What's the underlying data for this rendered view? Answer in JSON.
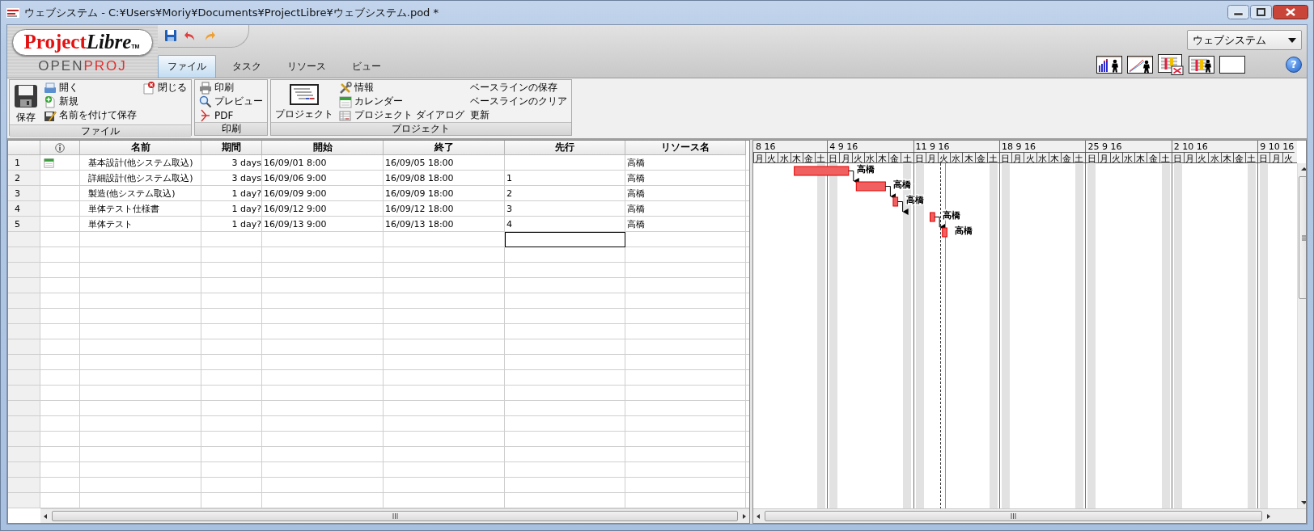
{
  "window": {
    "title": "ウェブシステム - C:¥Users¥Moriy¥Documents¥ProjectLibre¥ウェブシステム.pod *"
  },
  "logo": {
    "name_first": "Project",
    "name_second": "Libre",
    "trademark": "TM",
    "sub_first": "OPEN",
    "sub_second": "PROJ"
  },
  "tabs": [
    {
      "label": "ファイル",
      "selected": true
    },
    {
      "label": "タスク",
      "selected": false
    },
    {
      "label": "リソース",
      "selected": false
    },
    {
      "label": "ビュー",
      "selected": false
    }
  ],
  "project_selector": {
    "value": "ウェブシステム"
  },
  "help_button": {
    "label": "?"
  },
  "ribbon_groups": [
    {
      "label": "ファイル",
      "large": {
        "label": "保存"
      },
      "columns": [
        [
          {
            "label": "開く"
          },
          {
            "label": "新規"
          },
          {
            "label": "名前を付けて保存"
          }
        ],
        [
          {
            "label": "閉じる"
          }
        ]
      ]
    },
    {
      "label": "印刷",
      "columns": [
        [
          {
            "label": "印刷"
          },
          {
            "label": "プレビュー"
          },
          {
            "label": "PDF"
          }
        ]
      ]
    },
    {
      "label": "プロジェクト",
      "large": {
        "label": "プロジェクト"
      },
      "columns": [
        [
          {
            "label": "情報"
          },
          {
            "label": "カレンダー"
          },
          {
            "label": "プロジェクト ダイアログ"
          }
        ],
        [
          {
            "label": "ベースラインの保存"
          },
          {
            "label": "ベースラインのクリア"
          },
          {
            "label": "更新"
          }
        ]
      ]
    }
  ],
  "table": {
    "columns": [
      {
        "kind": "row",
        "focused": false
      },
      {
        "kind": "indicators",
        "focused": false
      },
      {
        "label": "名前",
        "kind": "name",
        "focused": false
      },
      {
        "label": "期間",
        "kind": "duration",
        "focused": false
      },
      {
        "label": "開始",
        "kind": "start",
        "focused": false
      },
      {
        "label": "終了",
        "kind": "finish",
        "focused": false
      },
      {
        "label": "先行",
        "kind": "predecessors",
        "focused": true
      },
      {
        "label": "リソース名",
        "kind": "resources",
        "focused": false
      }
    ],
    "rows": [
      {
        "row": "1",
        "indicator": true,
        "name": "基本設計(他システム取込)",
        "duration": "3 days",
        "start": "16/09/01 8:00",
        "finish": "16/09/05 18:00",
        "resources": "高橋",
        "bar_label": "高橋"
      },
      {
        "row": "2",
        "indicator": false,
        "name": "詳細設計(他システム取込)",
        "duration": "3 days",
        "start": "16/09/06 9:00",
        "finish": "16/09/08 18:00",
        "predecessors": "1",
        "resources": "高橋",
        "bar_label": "高橋"
      },
      {
        "row": "3",
        "indicator": false,
        "name": "製造(他システム取込)",
        "duration": "1 day?",
        "start": "16/09/09 9:00",
        "finish": "16/09/09 18:00",
        "predecessors": "2",
        "resources": "高橋",
        "bar_label": "高橋"
      },
      {
        "row": "4",
        "indicator": false,
        "name": "単体テスト仕様書",
        "duration": "1 day?",
        "start": "16/09/12 9:00",
        "finish": "16/09/12 18:00",
        "predecessors": "3",
        "resources": "高橋",
        "bar_label": "高橋"
      },
      {
        "row": "5",
        "indicator": false,
        "name": "単体テスト",
        "duration": "1 day?",
        "start": "16/09/13 9:00",
        "finish": "16/09/13 18:00",
        "predecessors": "4",
        "resources": "高橋",
        "bar_label": "高橋"
      }
    ]
  },
  "gantt": {
    "weeks": [
      {
        "label": "8 16",
        "days": [
          "月",
          "火",
          "水",
          "木",
          "金",
          "土"
        ]
      },
      {
        "label": "4 9 16",
        "days": [
          "日",
          "月",
          "火",
          "水",
          "木",
          "金",
          "土"
        ]
      },
      {
        "label": "11 9 16",
        "days": [
          "日",
          "月",
          "火",
          "水",
          "木",
          "金",
          "土"
        ]
      },
      {
        "label": "18 9 16",
        "days": [
          "日",
          "月",
          "火",
          "水",
          "木",
          "金",
          "土"
        ]
      },
      {
        "label": "25 9 16",
        "days": [
          "日",
          "月",
          "火",
          "水",
          "木",
          "金",
          "土"
        ]
      },
      {
        "label": "2 10 16",
        "days": [
          "日",
          "月",
          "火",
          "水",
          "木",
          "金",
          "土"
        ]
      },
      {
        "label": "9 10 16",
        "days": [
          "日",
          "月",
          "火"
        ]
      }
    ]
  }
}
